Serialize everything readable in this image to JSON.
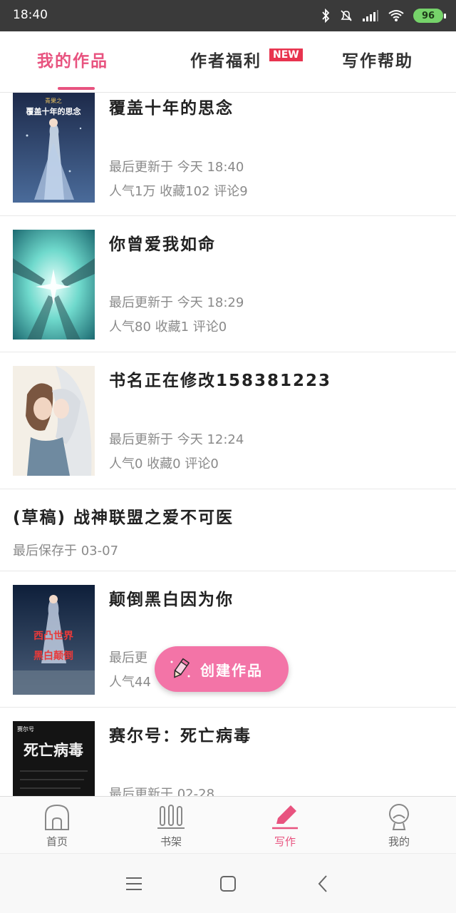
{
  "status_bar": {
    "time": "18:40",
    "battery": "96",
    "icons": [
      "bluetooth-icon",
      "mute-icon",
      "signal-icon",
      "wifi-icon",
      "battery-icon"
    ]
  },
  "tabs": [
    {
      "label": "我的作品",
      "active": true
    },
    {
      "label": "作者福利",
      "badge": "NEW"
    },
    {
      "label": "写作帮助"
    }
  ],
  "works": [
    {
      "title": "覆盖十年的思念",
      "updated": "最后更新于  今天  18:40",
      "stats": "人气1万  收藏102  评论9",
      "cover_text": [
        "青果之",
        "覆盖十年的思念"
      ]
    },
    {
      "title": "你曾爱我如命",
      "updated": "最后更新于  今天  18:29",
      "stats": "人气80  收藏1  评论0"
    },
    {
      "title": "书名正在修改158381223",
      "updated": "最后更新于  今天  12:24",
      "stats": "人气0  收藏0  评论0"
    },
    {
      "title": "(草稿) 战神联盟之爱不可医",
      "saved": "最后保存于  03-07",
      "draft": true
    },
    {
      "title": "颠倒黑白因为你",
      "updated": "最后更",
      "stats": "人气44",
      "cover_text": [
        "西凸世界",
        "黑白颠倒"
      ]
    },
    {
      "title": "赛尔号：死亡病毒",
      "updated": "最后更新于  02-28",
      "cover_text": [
        "赛尔号",
        "死亡病毒"
      ]
    }
  ],
  "fab": {
    "label": "创建作品"
  },
  "bottom_nav": [
    {
      "label": "首页",
      "icon": "home-icon"
    },
    {
      "label": "书架",
      "icon": "bookshelf-icon"
    },
    {
      "label": "写作",
      "icon": "pen-icon",
      "active": true
    },
    {
      "label": "我的",
      "icon": "profile-icon"
    }
  ],
  "colors": {
    "accent": "#e8537f",
    "fab": "#f374a7",
    "badge": "#e8344f",
    "meta_text": "#8a8a8a"
  }
}
